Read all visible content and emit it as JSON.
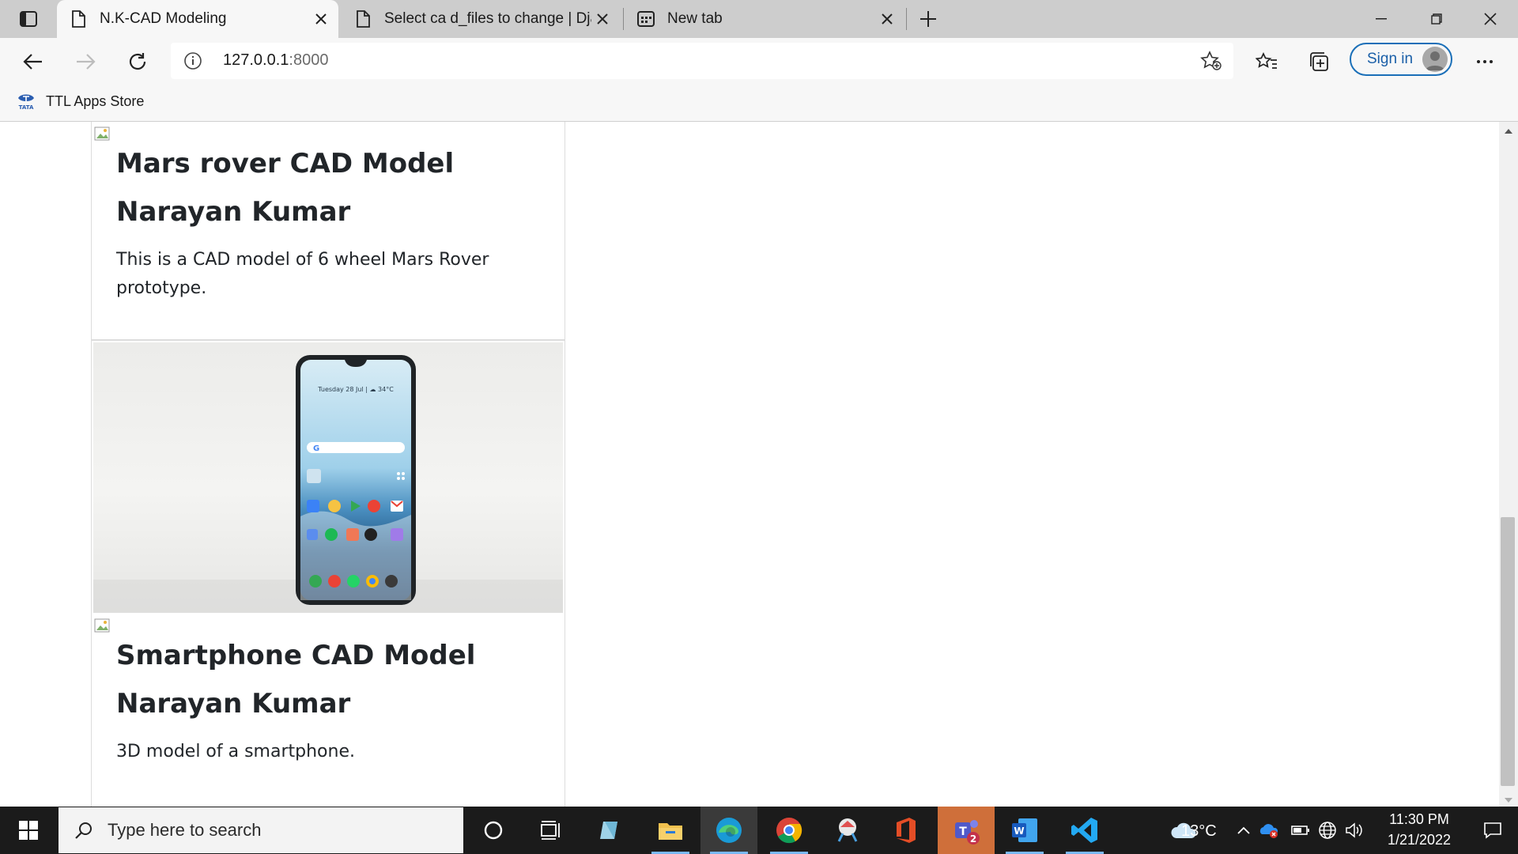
{
  "browser": {
    "tabs": [
      {
        "title": "N.K-CAD Modeling",
        "active": true
      },
      {
        "title": "Select ca d_files to change | Djan",
        "active": false
      },
      {
        "title": "New tab",
        "active": false
      }
    ],
    "address": {
      "host": "127.0.0.1",
      "port": ":8000"
    },
    "signin_label": "Sign in",
    "bookmarks": [
      {
        "label": "TTL Apps Store",
        "icon_text": "TATA"
      }
    ]
  },
  "cards": [
    {
      "title": "Mars rover CAD Model",
      "author": "Narayan Kumar",
      "description": "This is a CAD model of 6 wheel Mars Rover prototype."
    },
    {
      "title": "Smartphone CAD Model",
      "author": "Narayan Kumar",
      "description": "3D model of a smartphone.",
      "phone_screen_text": "Tuesday 28 Jul | ☁ 34°C"
    }
  ],
  "taskbar": {
    "search_placeholder": "Type here to search",
    "teams_badge": "2",
    "weather": "13°C",
    "time": "11:30 PM",
    "date": "1/21/2022"
  },
  "colors": {
    "accent": "#1a6fb8",
    "taskbar": "#1b1b1b",
    "chrome": "#f7f7f7"
  }
}
